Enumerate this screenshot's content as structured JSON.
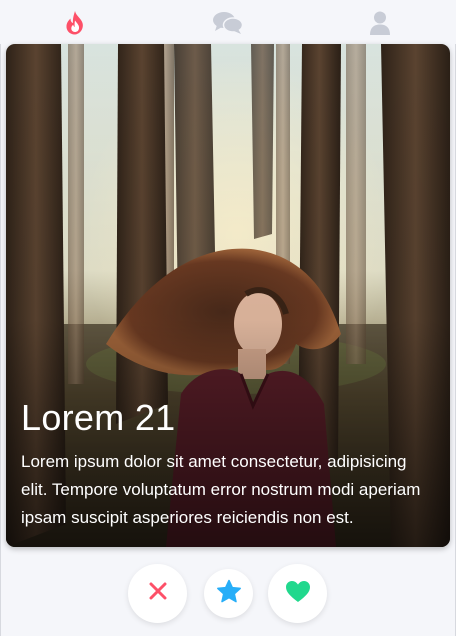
{
  "nav": {
    "items": [
      {
        "icon": "flame-icon",
        "active": true
      },
      {
        "icon": "chat-bubbles-icon",
        "active": false
      },
      {
        "icon": "user-icon",
        "active": false
      }
    ],
    "colors": {
      "active": "#fd5068",
      "inactive": "#c8ccd6"
    }
  },
  "card": {
    "title": "Lorem 21",
    "description": "Lorem ipsum dolor sit amet consectetur, adipisicing elit. Tempore voluptatum error nostrum modi aperiam ipsam suscipit asperiores reiciendis non est.",
    "photo": "woman-in-forest-photo"
  },
  "actions": {
    "nope": {
      "icon": "close-icon",
      "color": "#fd5068"
    },
    "star": {
      "icon": "star-icon",
      "color": "#27aef8"
    },
    "like": {
      "icon": "heart-icon",
      "color": "#21d88d"
    }
  }
}
